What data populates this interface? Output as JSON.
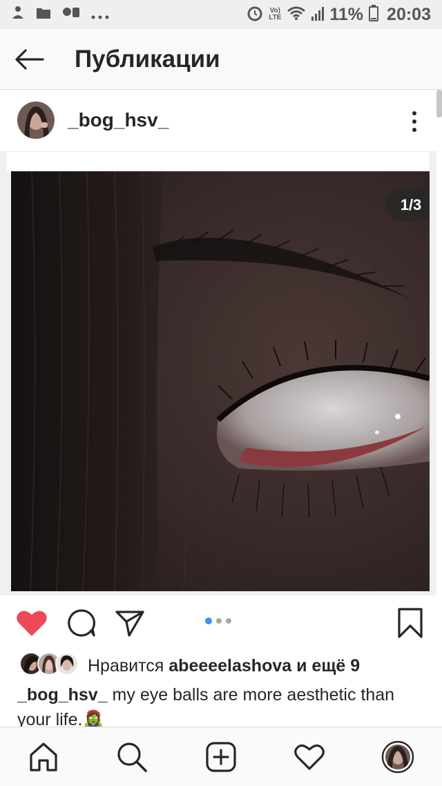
{
  "status_bar": {
    "volte_top": "Vo)",
    "volte_bottom": "LTE",
    "battery": "11%",
    "time": "20:03",
    "left_icons": [
      "incognito-icon",
      "folder-icon",
      "messenger-icon",
      "more-dots-icon"
    ],
    "right_icons": [
      "alarm-icon",
      "volte-icon",
      "wifi-icon",
      "signal-icon",
      "battery-icon"
    ]
  },
  "header": {
    "title": "Публикации",
    "back_icon": "arrow-left-icon"
  },
  "post": {
    "username": "_bog_hsv_",
    "page_counter": "1/3",
    "carousel": {
      "total": 3,
      "active": 1
    },
    "liked": true,
    "likes": {
      "prefix": "Нравится ",
      "user": "abeeeelashova",
      "suffix": " и ещё 9"
    },
    "caption": {
      "user": "_bog_hsv_",
      "text": " my eye balls are more aesthetic than your life.🧟‍♀️"
    }
  },
  "bottom_nav": {
    "items": [
      "home-icon",
      "search-icon",
      "add-post-icon",
      "activity-icon",
      "profile-icon"
    ]
  },
  "colors": {
    "like": "#ed4956",
    "carousel_active": "#3897f0",
    "text": "#262626"
  }
}
